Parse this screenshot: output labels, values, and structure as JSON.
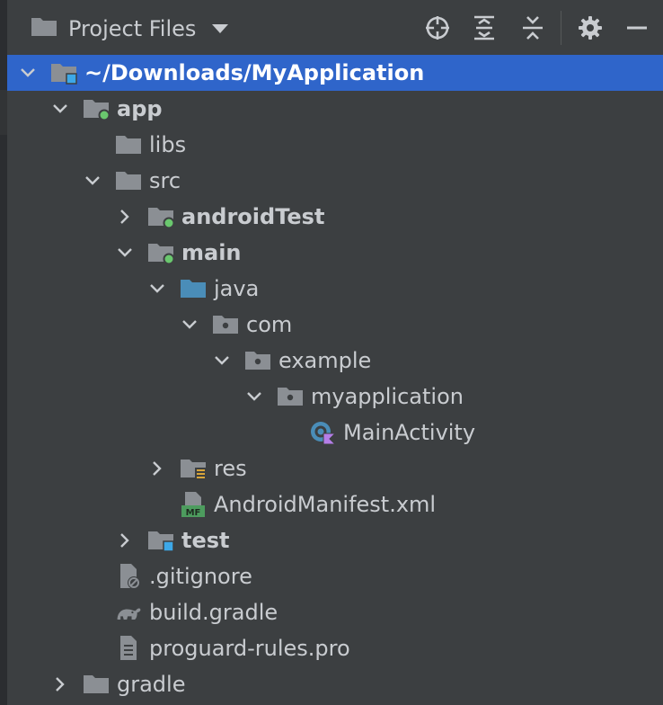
{
  "header": {
    "title": "Project Files",
    "tools": [
      "locate-icon",
      "expand-all-icon",
      "collapse-all-icon",
      "gear-icon",
      "minimize-icon"
    ]
  },
  "colors": {
    "background": "#3c3f41",
    "selection": "#2f65ca",
    "text": "#c9ccd0",
    "folder": "#8b8f94",
    "source_folder": "#4a8db8",
    "module_dot": "#6ac86e",
    "test_marker": "#3da8e8"
  },
  "tree": [
    {
      "label": "~/Downloads/MyApplication",
      "depth": 0,
      "chevron": "down",
      "icon": "module-folder-icon",
      "bold": true,
      "selected": true
    },
    {
      "label": "app",
      "depth": 1,
      "chevron": "down",
      "icon": "android-module-folder-icon",
      "bold": true
    },
    {
      "label": "libs",
      "depth": 2,
      "chevron": "none",
      "icon": "folder-icon"
    },
    {
      "label": "src",
      "depth": 2,
      "chevron": "down",
      "icon": "folder-icon"
    },
    {
      "label": "androidTest",
      "depth": 3,
      "chevron": "right",
      "icon": "android-module-folder-icon",
      "bold": true
    },
    {
      "label": "main",
      "depth": 3,
      "chevron": "down",
      "icon": "android-module-folder-icon",
      "bold": true
    },
    {
      "label": "java",
      "depth": 4,
      "chevron": "down",
      "icon": "source-folder-icon"
    },
    {
      "label": "com",
      "depth": 5,
      "chevron": "down",
      "icon": "package-icon"
    },
    {
      "label": "example",
      "depth": 6,
      "chevron": "down",
      "icon": "package-icon"
    },
    {
      "label": "myapplication",
      "depth": 7,
      "chevron": "down",
      "icon": "package-icon"
    },
    {
      "label": "MainActivity",
      "depth": 8,
      "chevron": "none",
      "icon": "kotlin-class-icon"
    },
    {
      "label": "res",
      "depth": 4,
      "chevron": "right",
      "icon": "resources-folder-icon"
    },
    {
      "label": "AndroidManifest.xml",
      "depth": 4,
      "chevron": "none",
      "icon": "manifest-file-icon"
    },
    {
      "label": "test",
      "depth": 3,
      "chevron": "right",
      "icon": "test-folder-icon",
      "bold": true
    },
    {
      "label": ".gitignore",
      "depth": 2,
      "chevron": "none",
      "icon": "ignored-file-icon"
    },
    {
      "label": "build.gradle",
      "depth": 2,
      "chevron": "none",
      "icon": "gradle-icon"
    },
    {
      "label": "proguard-rules.pro",
      "depth": 2,
      "chevron": "none",
      "icon": "text-file-icon"
    },
    {
      "label": "gradle",
      "depth": 1,
      "chevron": "right",
      "icon": "folder-icon"
    }
  ]
}
